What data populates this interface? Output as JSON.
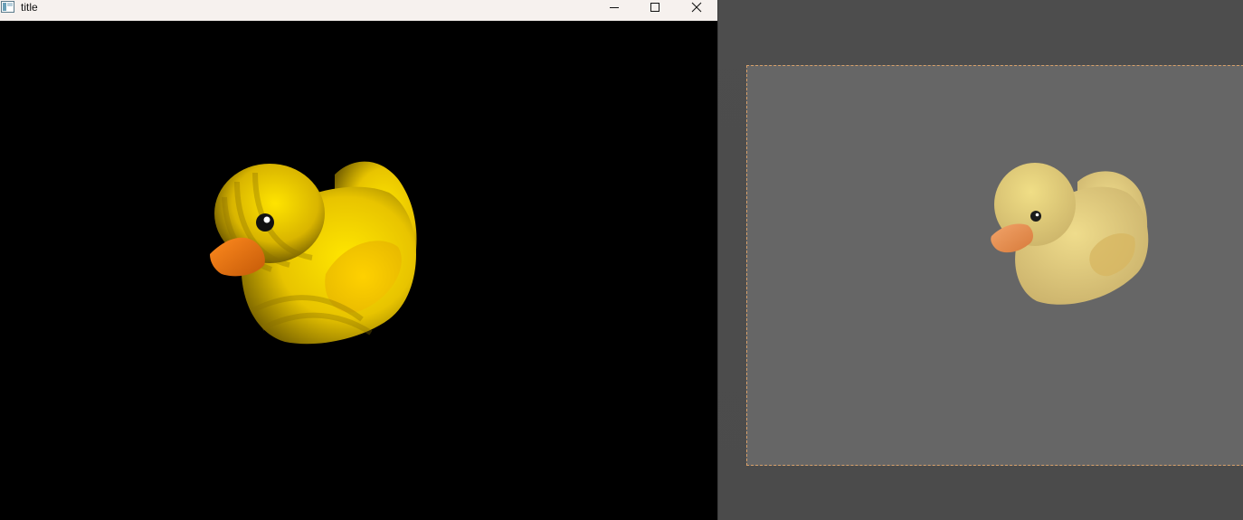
{
  "window": {
    "title": "title",
    "controls": {
      "minimize": "minimize-icon",
      "maximize": "maximize-icon",
      "close": "close-icon"
    }
  },
  "viewport": {
    "background": "#000000",
    "object": "rubber-duck-3d-render"
  },
  "reference_canvas": {
    "background": "#666666",
    "border_color": "#d9a16b",
    "object": "rubber-duck-reference-image"
  },
  "colors": {
    "duck_yellow": "#f2d200",
    "duck_shadow": "#7a6200",
    "beak_orange": "#e8781a",
    "reference_duck": "#dcc472",
    "reference_beak": "#e89050"
  }
}
